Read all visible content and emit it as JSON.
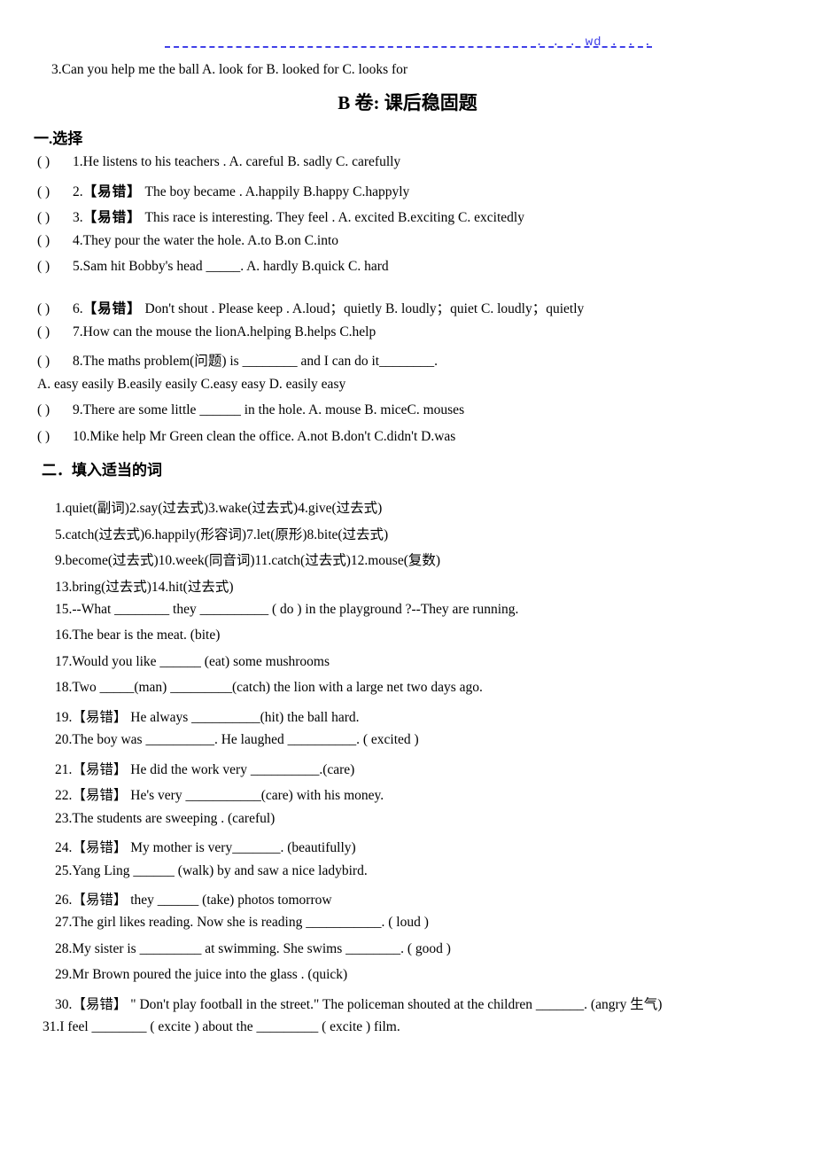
{
  "header": {
    "watermark": ". . . wd . . .",
    "rule_color": "#4040e8"
  },
  "lead_line": "3.Can you help me    the ball A. look for            B. looked for        C. looks for",
  "title": "B 卷: 课后稳固题",
  "sections": [
    {
      "heading": "一.选择",
      "questions": [
        {
          "mark": "(      )",
          "text": "1.He listens to his teachers .    A. careful           B. sadly           C. carefully"
        },
        {
          "mark": "(      )",
          "text": "2.",
          "tag": "【易错】",
          "rest": " The boy became .    A.happily          B.happy        C.happyly"
        },
        {
          "mark": "(      )",
          "text": "3.",
          "tag": "【易错】",
          "rest": " This race is interesting. They feel .    A. excited      B.exciting       C. excitedly"
        },
        {
          "mark": "(      )",
          "text": "4.They pour the water    the hole.   A.to            B.on           C.into"
        },
        {
          "mark": "(      )",
          "text": "5.Sam hit Bobby's head _____.    A. hardly        B.quick          C. hard"
        },
        {
          "mark": "(      )",
          "text": "6.",
          "tag": "【易错】",
          "rest": " Don't shout . Please keep . A.loud；quietly      B. loudly；quiet       C. loudly；quietly"
        },
        {
          "mark": "(      )",
          "text": "7.How can the mouse the lionA.helping          B.helps         C.help"
        },
        {
          "mark": "(      )",
          "text": "8.The maths problem(问题) is ________ and I can do it________."
        },
        {
          "mark": "",
          "text": "A. easy    easily                  B.easily        easily                 C.easy        easy          D. easily        easy"
        },
        {
          "mark": "(      )",
          "text": "9.There are some little ______ in the hole. A. mouse           B. miceC. mouses"
        },
        {
          "mark": "(      )",
          "text": "10.Mike    help Mr Green clean the office.    A.not         B.don't         C.didn't     D.was"
        }
      ]
    },
    {
      "heading": "二．填入适当的词",
      "items": [
        "1.quiet(副词)2.say(过去式)3.wake(过去式)4.give(过去式)",
        "5.catch(过去式)6.happily(形容词)7.let(原形)8.bite(过去式)",
        "9.become(过去式)10.week(同音词)11.catch(过去式)12.mouse(复数)",
        "13.bring(过去式)14.hit(过去式)",
        "15.--What ________ they __________ ( do ) in the playground ?--They are running.",
        "16.The bear is  the meat. (bite)",
        "17.Would you like ______ (eat) some mushrooms",
        "18.Two _____(man) _________(catch) the lion with a large net two days ago.",
        "19.【易错】 He always __________(hit) the ball hard.",
        "20.The boy was __________. He laughed __________. ( excited )",
        "21.【易错】 He did the work very __________.(care)",
        "22.【易错】 He's very ___________(care) with his money.",
        "23.The students are sweeping .  (careful)",
        "24.【易错】 My mother is very_______. (beautifully)",
        "25.Yang Ling ______ (walk) by and saw a nice ladybird.",
        "26.【易错】   they ______ (take) photos tomorrow",
        "27.The girl likes reading. Now she is reading ___________. ( loud )",
        "28.My sister is _________ at swimming. She swims ________. ( good )",
        "29.Mr Brown poured the juice into the glass .  (quick)",
        "30.【易错】 \" Don't play football in the street.\" The policeman shouted at the children _______. (angry 生气)",
        "31.I feel ________ ( excite ) about the _________ ( excite ) film."
      ]
    }
  ]
}
